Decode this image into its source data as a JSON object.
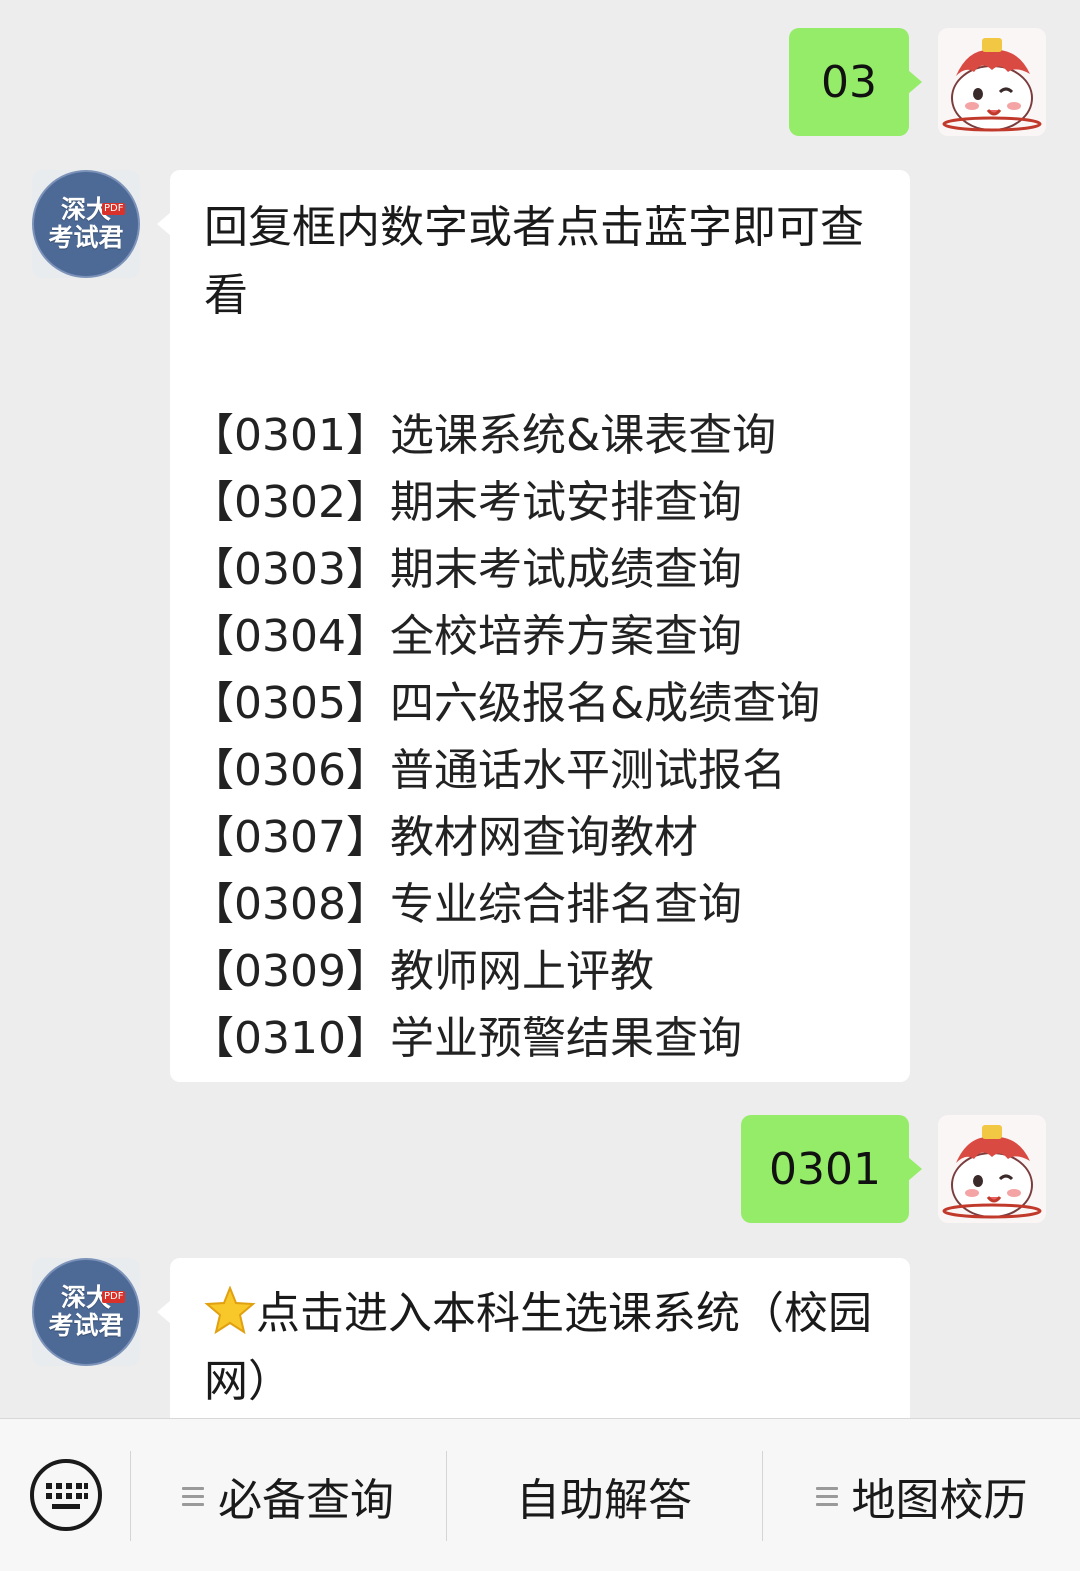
{
  "messages": [
    {
      "id": "m1",
      "direction": "out",
      "text": "03"
    },
    {
      "id": "m2",
      "direction": "in",
      "intro": "回复框内数字或者点击蓝字即可查看",
      "items": [
        "【0301】选课系统&课表查询",
        "【0302】期末考试安排查询",
        "【0303】期末考试成绩查询",
        "【0304】全校培养方案查询",
        "【0305】四六级报名&成绩查询",
        "【0306】普通话水平测试报名",
        "【0307】教材网查询教材",
        "【0308】专业综合排名查询",
        "【0309】教师网上评教",
        "【0310】学业预警结果查询"
      ]
    },
    {
      "id": "m3",
      "direction": "out",
      "text": "0301"
    },
    {
      "id": "m4",
      "direction": "in",
      "star_icon": "star-icon",
      "text": "点击进入本科生选课系统（校园网）"
    }
  ],
  "bot_avatar": {
    "line1": "深大",
    "line2": "考试君",
    "tag": "PDF"
  },
  "bottom_bar": {
    "keyboard_icon": "keyboard-icon",
    "menus": [
      "必备查询",
      "自助解答",
      "地图校历"
    ]
  },
  "colors": {
    "background": "#ededed",
    "outgoing_bubble": "#95ec69",
    "incoming_bubble": "#ffffff"
  }
}
